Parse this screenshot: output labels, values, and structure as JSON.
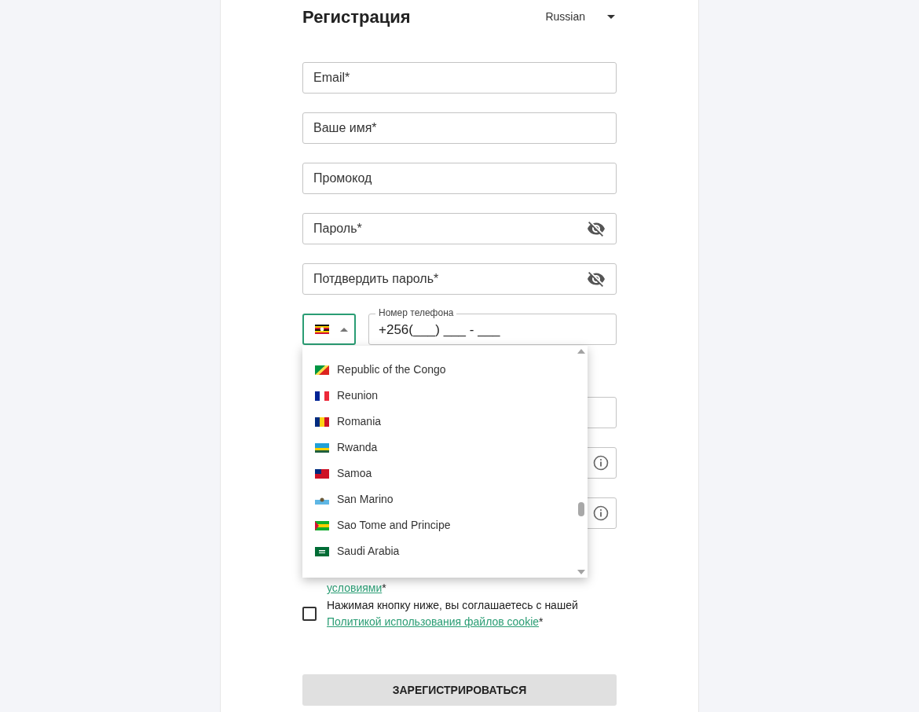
{
  "title": "Регистрация",
  "language": {
    "value": "Russian"
  },
  "fields": [
    {
      "placeholder": "Email*",
      "kind": "text"
    },
    {
      "placeholder": "Ваше имя*",
      "kind": "text"
    },
    {
      "placeholder": "Промокод",
      "kind": "text"
    },
    {
      "placeholder": "Пароль*",
      "kind": "password"
    },
    {
      "placeholder": "Потдвердить пароль*",
      "kind": "password"
    }
  ],
  "phone": {
    "label": "Номер телефона",
    "value": "+256(___) ___ - ___",
    "country_expanded": true
  },
  "country_list": [
    {
      "name": "Republic of the Congo",
      "selected": false
    },
    {
      "name": "Reunion",
      "selected": false
    },
    {
      "name": "Romania",
      "selected": false
    },
    {
      "name": "Rwanda",
      "selected": false
    },
    {
      "name": "Samoa",
      "selected": false
    },
    {
      "name": "San Marino",
      "selected": false
    },
    {
      "name": "Sao Tome and Principe",
      "selected": false
    },
    {
      "name": "Saudi Arabia",
      "selected": false
    }
  ],
  "hidden_fields": [
    {
      "kind": "plain"
    },
    {
      "kind": "info"
    },
    {
      "kind": "info"
    }
  ],
  "terms": {
    "link": "условиями",
    "suffix": "*"
  },
  "cookie": {
    "text": "Нажимая кнопку ниже, вы соглашаетесь с нашей",
    "link": "Политикой использования файлов cookie",
    "suffix": "*",
    "checked": false
  },
  "submit": "ЗАРЕГИСТРИРОВАТЬСЯ"
}
